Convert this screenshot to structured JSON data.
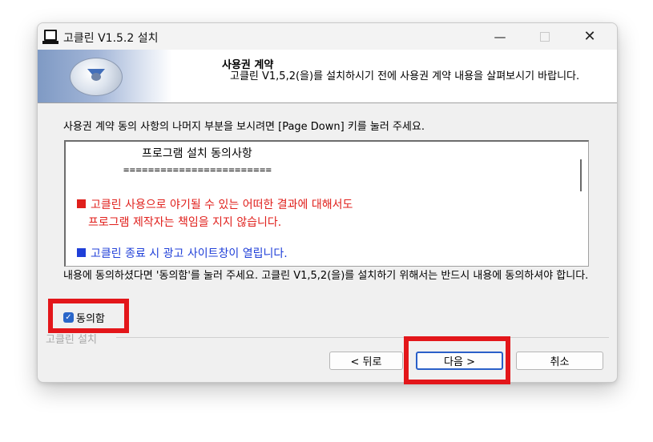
{
  "window": {
    "title": "고클린 V1.5.2 설치",
    "controls": {
      "minimize": "—",
      "maximize": "",
      "close": "✕"
    },
    "icon": "computer-icon"
  },
  "header": {
    "title": "사용권 계약",
    "subtitle": "고클린 V1,5,2(을)를 설치하시기 전에 사용권 계약 내용을 살펴보시기 바랍니다.",
    "banner_icon": "installer-disc-icon"
  },
  "main": {
    "instruction": "사용권 계약 동의 사항의 나머지 부분을 보시려면 [Page Down] 키를 눌러 주세요.",
    "license": {
      "heading": "프로그램 설치 동의사항",
      "separator": "========================",
      "red_line1": "고클린 사용으로 야기될 수 있는 어떠한 결과에 대해서도",
      "red_line2": "프로그램 제작자는 책임을 지지 않습니다.",
      "blue_line": "고클린 종료 시 광고 사이트창이 열립니다."
    },
    "agree_text": "내용에 동의하셨다면 '동의함'를 눌러 주세요. 고클린 V1,5,2(을)를 설치하기 위해서는 반드시 내용에 동의하셔야 합니다.",
    "agree_checkbox": {
      "label": "동의함",
      "checked": true
    }
  },
  "footer": {
    "group_label": "고클린 설치",
    "back": "< 뒤로",
    "next": "다음 >",
    "cancel": "취소"
  },
  "colors": {
    "highlight": "#e3161a",
    "license_red": "#e0201c",
    "license_blue": "#1f3fd8",
    "accent": "#2a5fc8"
  }
}
